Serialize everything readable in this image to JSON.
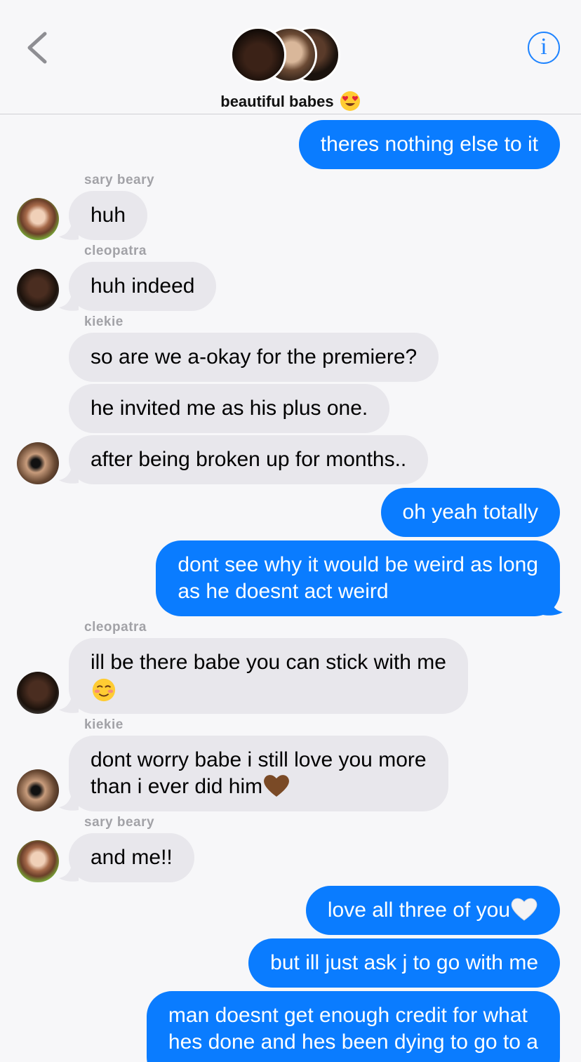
{
  "header": {
    "group_name": "beautiful babes",
    "group_emoji": "heart-eyes-emoji",
    "back_icon": "chevron-left-icon",
    "info_icon": "info-icon",
    "info_glyph": "i"
  },
  "colors": {
    "sent_bubble": "#0a7cff",
    "received_bubble": "#e8e7ec",
    "accent": "#1f84ff"
  },
  "messages": [
    {
      "type": "sent",
      "text": "theres nothing else to it"
    },
    {
      "type": "sender",
      "text": "sary beary"
    },
    {
      "type": "received",
      "text": "huh"
    },
    {
      "type": "sender",
      "text": "cleopatra"
    },
    {
      "type": "received",
      "text": "huh indeed"
    },
    {
      "type": "sender",
      "text": "kiekie"
    },
    {
      "type": "received",
      "text": "so are we a-okay for the premiere?"
    },
    {
      "type": "received",
      "text": "he invited me as his plus one."
    },
    {
      "type": "received",
      "text": "after being broken up for months.."
    },
    {
      "type": "sent",
      "text": "oh yeah totally"
    },
    {
      "type": "sent",
      "line1": "dont see why it would be weird as long",
      "line2": "as he doesnt act weird"
    },
    {
      "type": "sender",
      "text": "cleopatra"
    },
    {
      "type": "received",
      "line1": "ill be there babe you can stick with me",
      "emoji": "smiling-blush-emoji"
    },
    {
      "type": "sender",
      "text": "kiekie"
    },
    {
      "type": "received",
      "line1": "dont worry babe i still love you more",
      "line2": "than i ever did him",
      "emoji": "brown-heart-emoji"
    },
    {
      "type": "sender",
      "text": "sary beary"
    },
    {
      "type": "received",
      "text": "and me!!"
    },
    {
      "type": "sent",
      "text": "love all three of you",
      "emoji": "white-heart-emoji"
    },
    {
      "type": "sent",
      "text": "but ill just ask j to go with me"
    },
    {
      "type": "sent",
      "line1": "man doesnt get enough credit for what",
      "line2": "hes done and hes been dying to go to a"
    }
  ]
}
